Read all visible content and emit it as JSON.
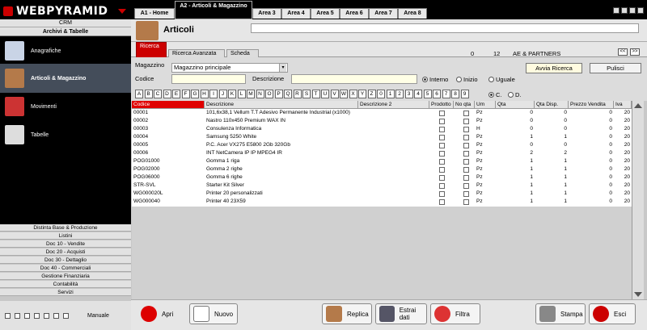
{
  "app": {
    "logo": "WEBPYRAMID"
  },
  "sidebar": {
    "crm": "CRM",
    "section": "Archivi & Tabelle",
    "items": [
      {
        "label": "Anagrafiche",
        "icon": "id-card-icon",
        "color": "#c9d4e6"
      },
      {
        "label": "Articoli & Magazzino",
        "icon": "box-icon",
        "color": "#b47a4a"
      },
      {
        "label": "Movimenti",
        "icon": "truck-icon",
        "color": "#c33"
      },
      {
        "label": "Tabelle",
        "icon": "table-icon",
        "color": "#ddd"
      }
    ],
    "menu": [
      "Distinta Base & Produzione",
      "Listini",
      "Doc 10 - Vendite",
      "Doc 20 - Acquisti",
      "Doc 30 - Dettaglio",
      "Doc 40 - Commerciali",
      "Gestione Finanziaria",
      "Contabilità",
      "Servizi"
    ],
    "manual": "Manuale"
  },
  "tabs": [
    "A1 - Home",
    "A2 - Articoli & Magazzino",
    "Area 3",
    "Area 4",
    "Area 5",
    "Area 6",
    "Area 7",
    "Area 8"
  ],
  "page": {
    "title": "Articoli"
  },
  "subtabs": [
    "Ricerca",
    "Ricerca Avanzata",
    "Scheda"
  ],
  "status": {
    "a": "0",
    "b": "12",
    "company": "AE & PARTNERS"
  },
  "nav": {
    "prev": "<<",
    "next": ">>"
  },
  "form": {
    "magazzino_label": "Magazzino",
    "magazzino_value": "Magazzino principale",
    "codice_label": "Codice",
    "descrizione_label": "Descrizione",
    "search_button": "Avvia Ricerca",
    "clear_button": "Pulisci",
    "radios": [
      "Interno",
      "Inizio",
      "Uguale"
    ],
    "order_radios": [
      "C.",
      "D."
    ]
  },
  "letters": [
    "A",
    "B",
    "C",
    "D",
    "E",
    "F",
    "G",
    "H",
    "I",
    "J",
    "K",
    "L",
    "M",
    "N",
    "O",
    "P",
    "Q",
    "R",
    "S",
    "T",
    "U",
    "V",
    "W",
    "X",
    "Y",
    "Z",
    "0",
    "1",
    "2",
    "3",
    "4",
    "5",
    "6",
    "7",
    "8",
    "9"
  ],
  "table": {
    "headers": [
      "Codice",
      "Descrizione",
      "Descrizione 2",
      "Prodotto",
      "No qta",
      "Um",
      "Qta",
      "Qta Disp.",
      "Prezzo Vendita",
      "Iva"
    ],
    "rows": [
      [
        "00001",
        "101,6x38,1 Vellum T.T Adesivo Permanente Industrial (x1000)",
        "",
        "",
        "",
        "Pz",
        "0",
        "0",
        "0",
        "20"
      ],
      [
        "00002",
        "Nastro 110x450 Premium WAX IN",
        "",
        "",
        "",
        "Pz",
        "0",
        "0",
        "0",
        "20"
      ],
      [
        "00003",
        "Consulenza Informatica",
        "",
        "",
        "",
        "H",
        "0",
        "0",
        "0",
        "20"
      ],
      [
        "00004",
        "Samsung 5250 White",
        "",
        "",
        "",
        "Pz",
        "1",
        "1",
        "0",
        "20"
      ],
      [
        "00005",
        "P.C. Acer VX275 E5800 2Gb 320Gb",
        "",
        "",
        "",
        "Pz",
        "0",
        "0",
        "0",
        "20"
      ],
      [
        "00006",
        "INT NetCamera IP IP MPEG4 IR",
        "",
        "",
        "",
        "Pz",
        "2",
        "2",
        "0",
        "20"
      ],
      [
        "POG01000",
        "Gomma 1 riga",
        "",
        "",
        "",
        "Pz",
        "1",
        "1",
        "0",
        "20"
      ],
      [
        "POG02000",
        "Gomma 2 righe",
        "",
        "",
        "",
        "Pz",
        "1",
        "1",
        "0",
        "20"
      ],
      [
        "POG06000",
        "Gomma 6 righe",
        "",
        "",
        "",
        "Pz",
        "1",
        "1",
        "0",
        "20"
      ],
      [
        "STR-SVL",
        "Starter Kit Silver",
        "",
        "",
        "",
        "Pz",
        "1",
        "1",
        "0",
        "20"
      ],
      [
        "WG000020L",
        "Printer 20 personalizzati",
        "",
        "",
        "",
        "Pz",
        "1",
        "1",
        "0",
        "20"
      ],
      [
        "WG000040",
        "Printer 40 23X59",
        "",
        "",
        "",
        "Pz",
        "1",
        "1",
        "0",
        "20"
      ]
    ]
  },
  "toolbar": [
    "Apri",
    "Nuovo",
    "Replica",
    "Estrai dati",
    "Filtra",
    "Stampa",
    "Esci"
  ]
}
